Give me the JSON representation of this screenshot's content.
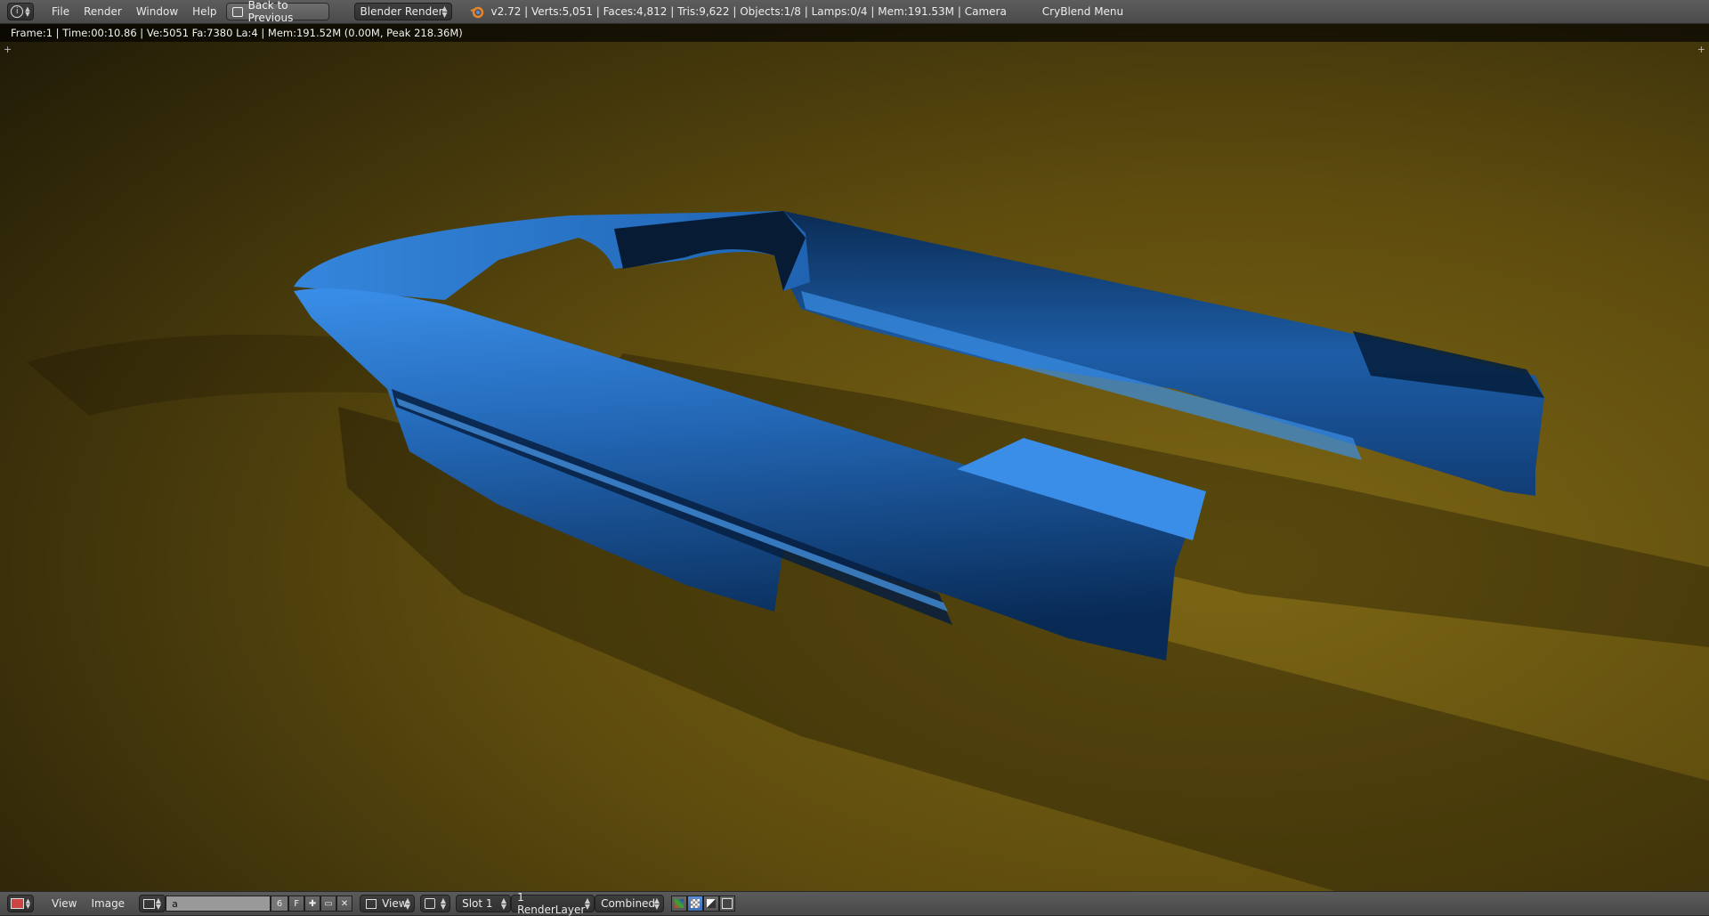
{
  "topbar": {
    "menu": [
      "File",
      "Render",
      "Window",
      "Help"
    ],
    "back_button": "Back to Previous",
    "render_engine": "Blender Render",
    "stats": "v2.72 | Verts:5,051 | Faces:4,812 | Tris:9,622 | Objects:1/8 | Lamps:0/4 | Mem:191.53M | Camera",
    "addon_menu": "CryBlend Menu"
  },
  "render_info": "Frame:1 | Time:00:10.86 | Ve:5051 Fa:7380 La:4 | Mem:191.52M (0.00M, Peak 218.36M)",
  "bottombar": {
    "menu": [
      "View",
      "Image"
    ],
    "image_name": "a",
    "user_count": "6",
    "fake_user": "F",
    "view_mode": "View",
    "slot": "Slot 1",
    "render_layer": "1 RenderLayer",
    "pass": "Combined"
  },
  "colors": {
    "floor_light": "#7a6412",
    "floor_dark": "#241d08",
    "car_blue": "#2f7fd6",
    "car_blue_dark": "#0d3d78"
  }
}
